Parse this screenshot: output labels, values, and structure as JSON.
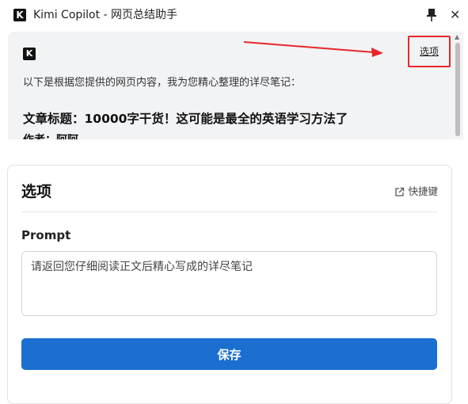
{
  "window": {
    "logo_letter": "K",
    "title": "Kimi Copilot - 网页总结助手",
    "close_glyph": "✕"
  },
  "summary": {
    "badge_letter": "K",
    "options_link": "选项",
    "intro": "以下是根据您提供的网页内容，我为您精心整理的详尽笔记：",
    "article_title": "文章标题：10000字干货！这可能是最全的英语学习方法了",
    "author_line": "作者：阿阿"
  },
  "options": {
    "title": "选项",
    "shortcut_label": "快捷键",
    "prompt_label": "Prompt",
    "prompt_value": "请返回您仔细阅读正文后精心写成的详尽笔记",
    "save_label": "保存"
  },
  "icons": {
    "pin": "pin-icon",
    "close": "close-icon",
    "external_link": "external-link-icon"
  },
  "colors": {
    "accent": "#1a6fd1",
    "annotation": "#e8262a",
    "panel_bg": "#f2f3f5"
  }
}
